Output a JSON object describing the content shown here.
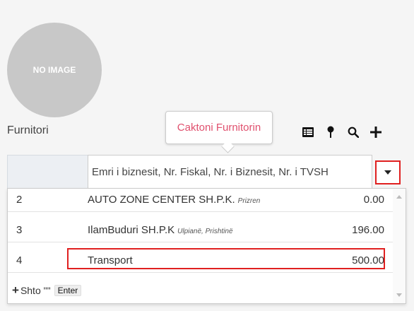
{
  "avatar": {
    "text": "NO IMAGE",
    "bg": "#c8c8c8"
  },
  "field": {
    "label": "Furnitori"
  },
  "tooltip": {
    "text": "Caktoni Furnitorin",
    "color": "#e0506e"
  },
  "toolbar": {
    "icons": [
      "list-card-icon",
      "map-pin-icon",
      "search-icon",
      "plus-icon"
    ]
  },
  "search": {
    "placeholder": "Emri i biznesit, Nr. Fiskal, Nr. i Biznesit, Nr. i TVSH"
  },
  "dropdown": {
    "rows": [
      {
        "num": "2",
        "name": "AUTO ZONE CENTER SH.P.K.",
        "location": "Prizren",
        "value": "0.00"
      },
      {
        "num": "3",
        "name": "IlamBuduri SH.P.K",
        "location": "Ulpianë, Prishtinë",
        "value": "196.00"
      },
      {
        "num": "4",
        "name": "Transport",
        "location": "",
        "value": "500.00"
      }
    ],
    "add_label": "Shto \"\"",
    "enter_label": "Enter"
  },
  "colors": {
    "highlight": "#e02020",
    "accent": "#e0506e"
  }
}
